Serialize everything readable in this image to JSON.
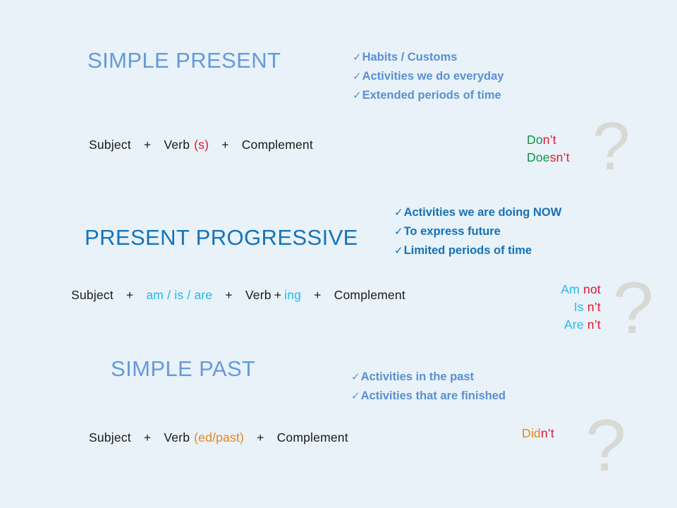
{
  "slide": {
    "background_color": "#e8f2f8",
    "colors": {
      "heading_light_blue": "#6699dd",
      "heading_dark_blue": "#1473ba",
      "bullets_light_blue": "#5b8fd4",
      "bullets_dark_blue": "#1471b8",
      "formula_text": "#1a1a1a",
      "accent_red": "#e8112d",
      "accent_cyan": "#27b6f0",
      "accent_orange": "#e8841a",
      "accent_green": "#0c9244",
      "question_mark_gray": "#d8d8d4"
    }
  },
  "sections": [
    {
      "id": "simple-present",
      "heading": "SIMPLE PRESENT",
      "bullet_marker": "✓",
      "bullets": [
        "Habits / Customs",
        "Activities we do everyday",
        "Extended periods of time"
      ],
      "formula": {
        "subject": "Subject",
        "plus1": "+",
        "verb": "Verb",
        "verb_suffix": "(s)",
        "plus2": "+",
        "complement": "Complement"
      },
      "negatives": [
        {
          "stem": "Do",
          "stem_color": "green",
          "contraction": "n’t",
          "contraction_color": "red"
        },
        {
          "stem": "Doe",
          "stem_color": "green",
          "contraction": "sn’t",
          "contraction_color": "red"
        }
      ],
      "question_mark": "?"
    },
    {
      "id": "present-progressive",
      "heading": "PRESENT PROGRESSIVE",
      "bullet_marker": "✓",
      "bullets": [
        "Activities we are doing NOW",
        "To express future",
        "Limited periods of time"
      ],
      "formula": {
        "subject": "Subject",
        "plus1": "+",
        "auxiliaries": "am / is / are",
        "plus2": "+",
        "verb": "Verb",
        "plus_inner": "+",
        "verb_suffix": "ing",
        "plus3": "+",
        "complement": "Complement"
      },
      "negatives": [
        {
          "stem": "Am",
          "stem_color": "cyan",
          "contraction": "not",
          "contraction_color": "red"
        },
        {
          "stem": "Is",
          "stem_color": "cyan",
          "contraction": "n’t",
          "contraction_color": "red"
        },
        {
          "stem": "Are",
          "stem_color": "cyan",
          "contraction": "n’t",
          "contraction_color": "red"
        }
      ],
      "question_mark": "?"
    },
    {
      "id": "simple-past",
      "heading": "SIMPLE PAST",
      "bullet_marker": "✓",
      "bullets": [
        "Activities in the past",
        "Activities that are finished"
      ],
      "formula": {
        "subject": "Subject",
        "plus1": "+",
        "verb": "Verb",
        "verb_suffix": "(ed/past)",
        "plus2": "+",
        "complement": "Complement"
      },
      "negatives": [
        {
          "stem": "Did",
          "stem_color": "orange",
          "contraction": "n’t",
          "contraction_color": "red"
        }
      ],
      "question_mark": "?"
    }
  ]
}
